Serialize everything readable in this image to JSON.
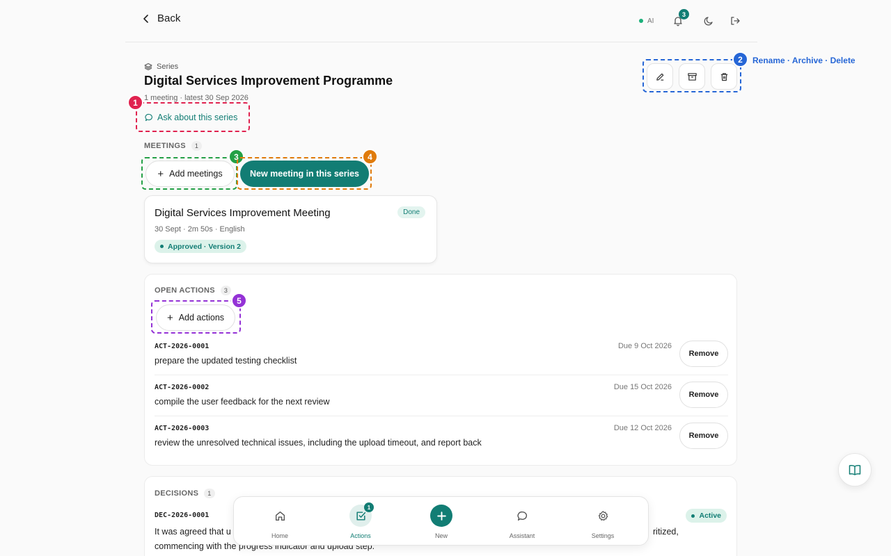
{
  "topbar": {
    "back_label": "Back",
    "ai_label": "AI",
    "notification_count": "3"
  },
  "header": {
    "series_label": "Series",
    "title": "Digital Services Improvement Programme",
    "subtitle": "1 meeting · latest 30 Sep 2026",
    "ask_label": "Ask about this series",
    "annotation_text": "Rename · Archive · Delete"
  },
  "meetings": {
    "label": "MEETINGS",
    "count": "1",
    "add_label": "Add meetings",
    "new_label": "New meeting in this series",
    "card": {
      "title": "Digital Services Improvement Meeting",
      "status": "Done",
      "meta": "30 Sept · 2m 50s · English",
      "approval": "Approved · Version 2"
    }
  },
  "actions": {
    "label": "OPEN ACTIONS",
    "count": "3",
    "add_label": "Add actions",
    "remove_label": "Remove",
    "items": [
      {
        "id": "ACT-2026-0001",
        "text": "prepare the updated testing checklist",
        "due": "Due 9 Oct 2026"
      },
      {
        "id": "ACT-2026-0002",
        "text": "compile the user feedback for the next review",
        "due": "Due 15 Oct 2026"
      },
      {
        "id": "ACT-2026-0003",
        "text": "review the unresolved technical issues, including the upload timeout, and report back",
        "due": "Due 12 Oct 2026"
      }
    ]
  },
  "decisions": {
    "label": "DECISIONS",
    "count": "1",
    "items": [
      {
        "id": "DEC-2026-0001",
        "status": "Active",
        "text_start": "It was agreed that u",
        "text_end": "ritized,",
        "text_line2": "commencing with the progress indicator and upload step."
      }
    ]
  },
  "annotations": [
    "1",
    "2",
    "3",
    "4",
    "5"
  ],
  "bottom_nav": {
    "items": [
      {
        "label": "Home",
        "icon": "home-icon"
      },
      {
        "label": "Actions",
        "icon": "check-square-icon",
        "badge": "1"
      },
      {
        "label": "New",
        "icon": "plus-icon"
      },
      {
        "label": "Assistant",
        "icon": "chat-bubble-icon"
      },
      {
        "label": "Settings",
        "icon": "gear-icon"
      }
    ]
  },
  "colors": {
    "accent": "#127d74",
    "annot_red": "#e0224f",
    "annot_blue": "#2666d6",
    "annot_green": "#24a046",
    "annot_orange": "#e07b0b",
    "annot_purple": "#9432d6"
  }
}
